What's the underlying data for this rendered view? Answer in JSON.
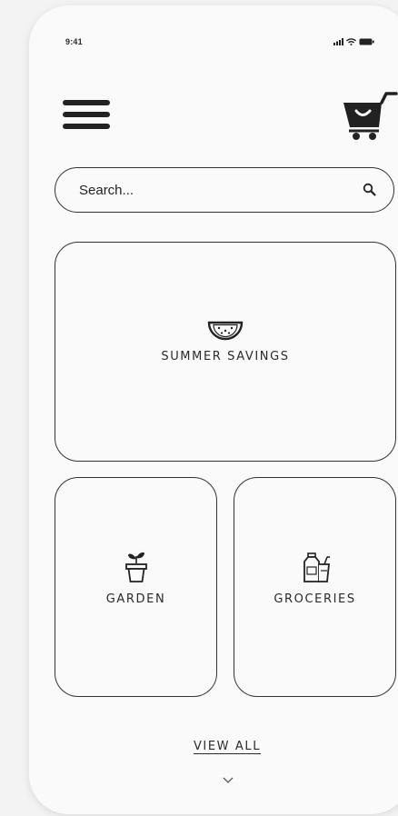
{
  "status_bar": {
    "time": "9:41",
    "icons": [
      "signal-icon",
      "wifi-icon",
      "battery-icon"
    ]
  },
  "header": {
    "menu_icon": "hamburger-menu-icon",
    "cart_icon": "shopping-cart-icon"
  },
  "search": {
    "placeholder": "Search...",
    "value": "",
    "icon": "search-icon"
  },
  "categories": [
    {
      "label": "SUMMER SAVINGS",
      "icon": "watermelon-icon"
    },
    {
      "label": "GARDEN",
      "icon": "plant-pot-icon"
    },
    {
      "label": "GROCERIES",
      "icon": "bottles-icon"
    }
  ],
  "footer": {
    "view_all_label": "VIEW ALL",
    "expand_icon": "chevron-down-icon"
  },
  "colors": {
    "background": "#f3f3f3",
    "phone": "#fafafa",
    "ink": "#2a2a2a"
  }
}
